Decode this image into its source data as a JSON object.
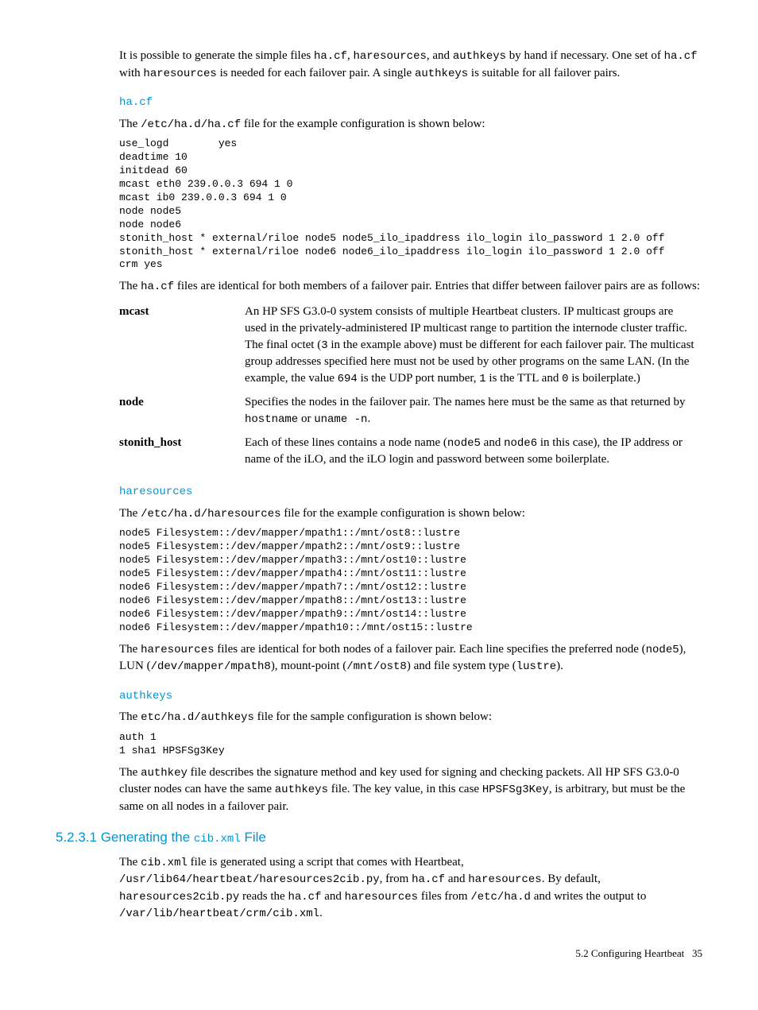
{
  "intro": {
    "p1_a": "It is possible to generate the simple files ",
    "p1_code1": "ha.cf",
    "p1_b": ", ",
    "p1_code2": "haresources",
    "p1_c": ", and ",
    "p1_code3": "authkeys",
    "p1_d": " by hand if necessary. One set of ",
    "p1_code4": "ha.cf",
    "p1_e": " with ",
    "p1_code5": "haresources",
    "p1_f": " is needed for each failover pair. A single ",
    "p1_code6": "authkeys",
    "p1_g": " is suitable for all failover pairs."
  },
  "hacf": {
    "heading": "ha.cf",
    "p1_a": "The ",
    "p1_code1": "/etc/ha.d/ha.cf",
    "p1_b": " file for the example configuration is shown below:",
    "code": "use_logd        yes\ndeadtime 10\ninitdead 60\nmcast eth0 239.0.0.3 694 1 0\nmcast ib0 239.0.0.3 694 1 0\nnode node5\nnode node6\nstonith_host * external/riloe node5 node5_ilo_ipaddress ilo_login ilo_password 1 2.0 off\nstonith_host * external/riloe node6 node6_ilo_ipaddress ilo_login ilo_password 1 2.0 off\ncrm yes",
    "p2_a": "The ",
    "p2_code1": "ha.cf",
    "p2_b": " files are identical for both members of a failover pair. Entries that differ between failover pairs are as follows:",
    "defs": {
      "mcast": {
        "term": "mcast",
        "d_a": "An HP SFS G3.0-0 system consists of multiple Heartbeat clusters. IP multicast groups are used in the privately-administered IP multicast range to partition the internode cluster traffic. The final octet (",
        "d_code1": "3",
        "d_b": " in the example above) must be different for each failover pair. The multicast group addresses specified here must not be used by other programs on the same LAN. (In the example, the value ",
        "d_code2": "694",
        "d_c": " is the UDP port number, ",
        "d_code3": "1",
        "d_d": " is the TTL and ",
        "d_code4": "0",
        "d_e": " is boilerplate.)"
      },
      "node": {
        "term": "node",
        "d_a": "Specifies the nodes in the failover pair. The names here must be the same as that returned by ",
        "d_code1": "hostname",
        "d_b": " or ",
        "d_code2": "uname -n",
        "d_c": "."
      },
      "stonith": {
        "term": "stonith_host",
        "d_a": "Each of these lines contains a node name (",
        "d_code1": "node5",
        "d_b": " and ",
        "d_code2": "node6",
        "d_c": " in this case), the IP address or name of the iLO, and the iLO login and password between some boilerplate."
      }
    }
  },
  "haresources": {
    "heading": "haresources",
    "p1_a": "The ",
    "p1_code1": "/etc/ha.d/haresources",
    "p1_b": " file for the example configuration is shown below:",
    "code": "node5 Filesystem::/dev/mapper/mpath1::/mnt/ost8::lustre\nnode5 Filesystem::/dev/mapper/mpath2::/mnt/ost9::lustre\nnode5 Filesystem::/dev/mapper/mpath3::/mnt/ost10::lustre\nnode5 Filesystem::/dev/mapper/mpath4::/mnt/ost11::lustre\nnode6 Filesystem::/dev/mapper/mpath7::/mnt/ost12::lustre\nnode6 Filesystem::/dev/mapper/mpath8::/mnt/ost13::lustre\nnode6 Filesystem::/dev/mapper/mpath9::/mnt/ost14::lustre\nnode6 Filesystem::/dev/mapper/mpath10::/mnt/ost15::lustre",
    "p2_a": "The ",
    "p2_code1": "haresources",
    "p2_b": " files are identical for both nodes of a failover pair. Each line specifies the preferred node (",
    "p2_code2": "node5",
    "p2_c": "), LUN (",
    "p2_code3": "/dev/mapper/mpath8",
    "p2_d": "), mount-point (",
    "p2_code4": "/mnt/ost8",
    "p2_e": ") and file system type (",
    "p2_code5": "lustre",
    "p2_f": ")."
  },
  "authkeys": {
    "heading": "authkeys",
    "p1_a": "The ",
    "p1_code1": "etc/ha.d/authkeys",
    "p1_b": " file for the sample configuration is shown below:",
    "code": "auth 1\n1 sha1 HPSFSg3Key",
    "p2_a": "The ",
    "p2_code1": "authkey",
    "p2_b": " file describes the signature method and key used for signing and checking packets. All HP SFS G3.0-0 cluster nodes can have the same ",
    "p2_code2": "authkeys",
    "p2_c": " file. The key value, in this case ",
    "p2_code3": "HPSFSg3Key",
    "p2_d": ", is arbitrary, but must be the same on all nodes in a failover pair."
  },
  "cibxml": {
    "heading_a": "5.2.3.1 Generating the ",
    "heading_code": "cib.xml",
    "heading_b": " File",
    "p1_a": "The ",
    "p1_code1": "cib.xml",
    "p1_b": " file is generated using a script that comes with Heartbeat, ",
    "p1_code2": "/usr/lib64/heartbeat/haresources2cib.py",
    "p1_c": ", from ",
    "p1_code3": "ha.cf",
    "p1_d": " and ",
    "p1_code4": "haresources",
    "p1_e": ". By default, ",
    "p1_code5": "haresources2cib.py",
    "p1_f": " reads the ",
    "p1_code6": "ha.cf",
    "p1_g": " and ",
    "p1_code7": "haresources",
    "p1_h": " files from ",
    "p1_code8": "/etc/ha.d",
    "p1_i": " and writes the output to ",
    "p1_code9": "/var/lib/heartbeat/crm/cib.xml",
    "p1_j": "."
  },
  "footer": {
    "section": "5.2 Configuring Heartbeat",
    "page": "35"
  }
}
